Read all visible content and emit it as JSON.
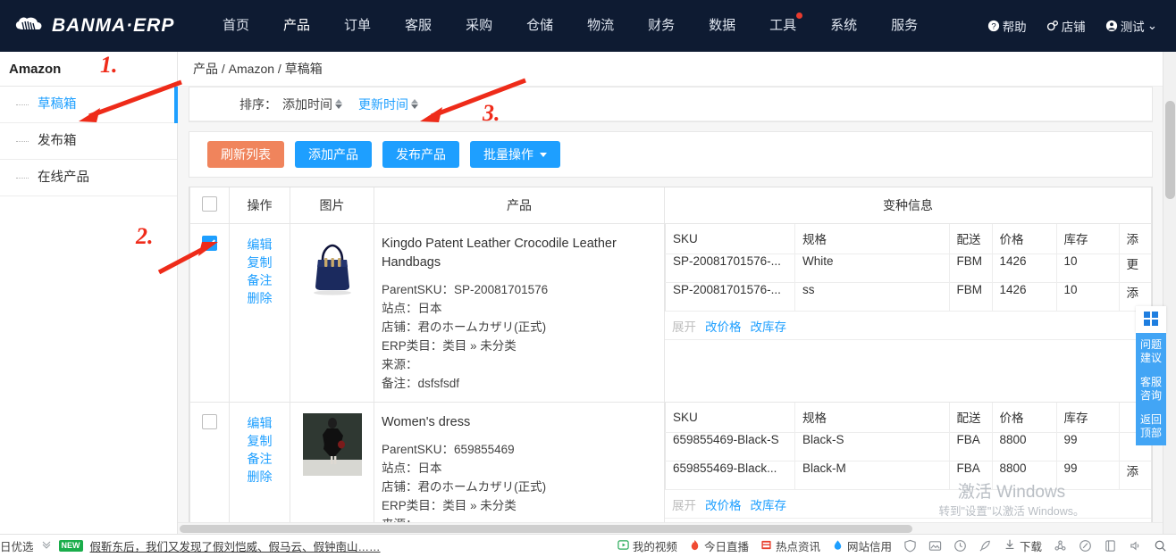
{
  "header": {
    "brand": "BANMA·ERP",
    "nav": [
      {
        "label": "首页",
        "dot": false
      },
      {
        "label": "产品",
        "dot": false
      },
      {
        "label": "订单",
        "dot": false
      },
      {
        "label": "客服",
        "dot": false
      },
      {
        "label": "采购",
        "dot": false
      },
      {
        "label": "仓储",
        "dot": false
      },
      {
        "label": "物流",
        "dot": false
      },
      {
        "label": "财务",
        "dot": false
      },
      {
        "label": "数据",
        "dot": false
      },
      {
        "label": "工具",
        "dot": true
      },
      {
        "label": "系统",
        "dot": false
      },
      {
        "label": "服务",
        "dot": false
      }
    ],
    "right": [
      {
        "label": "帮助",
        "icon": "help-icon"
      },
      {
        "label": "店铺",
        "icon": "shop-gear-icon"
      },
      {
        "label": "测试",
        "icon": "user-icon",
        "caret": "⌄"
      }
    ]
  },
  "sidebar": {
    "title": "Amazon",
    "items": [
      {
        "label": "草稿箱",
        "selected": true
      },
      {
        "label": "发布箱",
        "selected": false
      },
      {
        "label": "在线产品",
        "selected": false
      }
    ]
  },
  "breadcrumb": "产品 / Amazon / 草稿箱",
  "sortbar": {
    "label": "排序：",
    "options": [
      {
        "label": "添加时间",
        "active": false
      },
      {
        "label": "更新时间",
        "active": true
      }
    ]
  },
  "toolbar": {
    "refresh_label": "刷新列表",
    "add_label": "添加产品",
    "publish_label": "发布产品",
    "batch_label": "批量操作",
    "colors": {
      "orange": "#f0845c",
      "blue": "#1e9fff"
    }
  },
  "table": {
    "headers": [
      "操作",
      "图片",
      "产品",
      "变种信息"
    ],
    "variant_headers": [
      "SKU",
      "规格",
      "配送",
      "价格",
      "库存",
      "添"
    ],
    "variant_actions": {
      "expand": "展开",
      "price": "改价格",
      "stock": "改库存"
    },
    "row_actions": [
      "编辑",
      "复制",
      "备注",
      "删除"
    ],
    "time_col": [
      "添",
      "更"
    ],
    "rows": [
      {
        "checked": true,
        "title": "Kingdo Patent Leather Crocodile Leather Handbags",
        "parent_sku_label": "ParentSKU：",
        "parent_sku": "SP-20081701576",
        "site_label": "站点：",
        "site": "日本",
        "shop_label": "店铺：",
        "shop": "君のホームカザリ(正式)",
        "cat_label": "ERP类目：",
        "cat": "类目 » 未分类",
        "source_label": "来源：",
        "source": "",
        "note_label": "备注：",
        "note": "dsfsfsdf",
        "thumb": "navy-handbag",
        "variants": [
          {
            "sku": "SP-20081701576-...",
            "spec": "White",
            "ship": "FBM",
            "price": "1426",
            "stock": "10"
          },
          {
            "sku": "SP-20081701576-...",
            "spec": "ss",
            "ship": "FBM",
            "price": "1426",
            "stock": "10"
          }
        ]
      },
      {
        "checked": false,
        "title": "Women's dress",
        "parent_sku_label": "ParentSKU：",
        "parent_sku": "659855469",
        "site_label": "站点：",
        "site": "日本",
        "shop_label": "店铺：",
        "shop": "君のホームカザリ(正式)",
        "cat_label": "ERP类目：",
        "cat": "类目 » 未分类",
        "source_label": "来源：",
        "source": "",
        "note_label": "",
        "note": "",
        "thumb": "black-dress",
        "variants": [
          {
            "sku": "659855469-Black-S",
            "spec": "Black-S",
            "ship": "FBA",
            "price": "8800",
            "stock": "99"
          },
          {
            "sku": "659855469-Black...",
            "spec": "Black-M",
            "ship": "FBA",
            "price": "8800",
            "stock": "99"
          }
        ]
      }
    ]
  },
  "float_widget": {
    "grid_icon": "grid-icon",
    "buttons": [
      {
        "line1": "问题",
        "line2": "建议"
      },
      {
        "line1": "客服",
        "line2": "咨询"
      },
      {
        "line1": "返回",
        "line2": "顶部"
      }
    ]
  },
  "watermark": {
    "line1": "激活 Windows",
    "line2": "转到\"设置\"以激活 Windows。"
  },
  "bottombar": {
    "left_text": "日优选",
    "tag": "NEW",
    "news": "假靳东后，我们又发现了假刘恺威、假马云、假钟南山……",
    "items": [
      {
        "label": "我的视频",
        "icon": "play-icon"
      },
      {
        "label": "今日直播",
        "icon": "flame-icon"
      },
      {
        "label": "热点资讯",
        "icon": "news-icon"
      },
      {
        "label": "网站信用",
        "icon": "drop-icon"
      },
      {
        "label": "",
        "icon": "shield-icon"
      },
      {
        "label": "",
        "icon": "image-icon"
      },
      {
        "label": "",
        "icon": "clock-icon"
      },
      {
        "label": "",
        "icon": "rocket-icon"
      },
      {
        "label": "下载",
        "icon": "download-icon"
      },
      {
        "label": "",
        "icon": "share-icon"
      },
      {
        "label": "",
        "icon": "pen-icon"
      },
      {
        "label": "",
        "icon": "window-icon"
      },
      {
        "label": "",
        "icon": "speaker-icon"
      },
      {
        "label": "",
        "icon": "search-icon"
      }
    ]
  },
  "annotations": [
    {
      "num": "1.",
      "target": "sidebar-draft-item"
    },
    {
      "num": "2.",
      "target": "row-checkbox"
    },
    {
      "num": "3.",
      "target": "publish-product-button"
    }
  ]
}
